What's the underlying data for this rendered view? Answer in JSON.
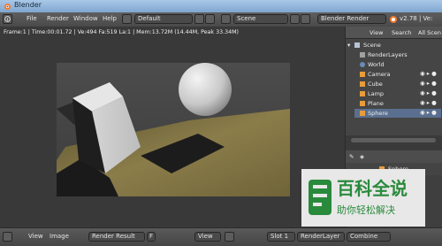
{
  "window": {
    "title": "Blender"
  },
  "menubar": {
    "items": [
      "File",
      "Render",
      "Window",
      "Help"
    ],
    "screen_layout": "Default",
    "scene": "Scene",
    "render_engine": "Blender Render",
    "version_info": "v2.78 | Ve:"
  },
  "viewport": {
    "info": "Frame:1 | Time:00:01.72 | Ve:494 Fa:519 La:1 | Mem:13.72M (14.44M, Peak 33.34M)"
  },
  "outliner": {
    "tabs": [
      "View",
      "Search",
      "All Scen"
    ],
    "tree": [
      "Scene",
      "RenderLayers",
      "World",
      "Camera",
      "Cube",
      "Lamp",
      "Plane",
      "Sphere"
    ]
  },
  "properties": {
    "active_object": "Sphere"
  },
  "bottombar": {
    "items": [
      "View",
      "Image",
      "Render Result",
      "F",
      "View",
      "Slot 1",
      "RenderLayer",
      "Combine"
    ]
  },
  "watermark": {
    "title": "百科全说",
    "subtitle": "助你轻松解决"
  },
  "colors": {
    "accent": "#5a7fb5",
    "viewport_bg": "#393939",
    "panel_bg": "#454545",
    "floor": "#7e7142",
    "watermark_green": "#2a8a3c"
  }
}
